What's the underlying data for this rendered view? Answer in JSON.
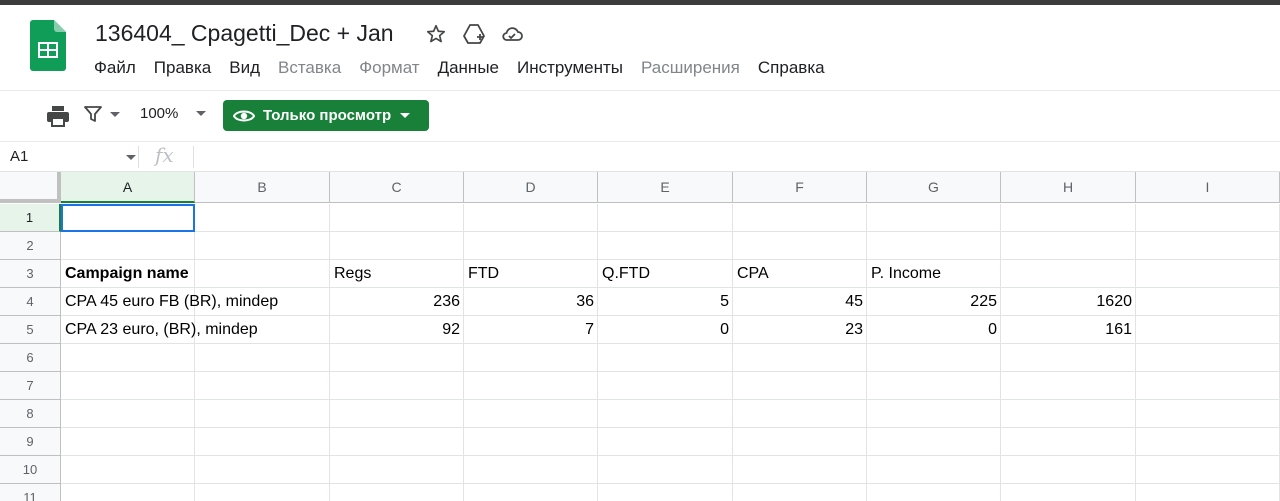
{
  "document": {
    "title": "136404_ Cpagetti_Dec + Jan"
  },
  "icons": {
    "star": "star-icon",
    "move_to_drive": "drive-move-icon",
    "cloud_status": "cloud-saved-icon"
  },
  "menu": [
    {
      "label": "Файл",
      "disabled": false
    },
    {
      "label": "Правка",
      "disabled": false
    },
    {
      "label": "Вид",
      "disabled": false
    },
    {
      "label": "Вставка",
      "disabled": true
    },
    {
      "label": "Формат",
      "disabled": true
    },
    {
      "label": "Данные",
      "disabled": false
    },
    {
      "label": "Инструменты",
      "disabled": false
    },
    {
      "label": "Расширения",
      "disabled": true
    },
    {
      "label": "Справка",
      "disabled": false
    }
  ],
  "toolbar": {
    "zoom": "100%",
    "view_only_label": "Только просмотр"
  },
  "formula_bar": {
    "cell_ref": "A1",
    "fx": "fx",
    "value": ""
  },
  "columns": [
    "A",
    "B",
    "C",
    "D",
    "E",
    "F",
    "G",
    "H",
    "I"
  ],
  "rows": [
    "1",
    "2",
    "3",
    "4",
    "5",
    "6",
    "7",
    "8",
    "9",
    "10",
    "11"
  ],
  "cells": {
    "A3": "Campaign name",
    "C3": "Regs",
    "D3": "FTD",
    "E3": "Q.FTD",
    "F3": "CPA",
    "G3": "P. Income",
    "A4": "CPA 45 euro FB (BR), mindep",
    "C4": "236",
    "D4": "36",
    "E4": "5",
    "F4": "45",
    "G4": "225",
    "H4": "1620",
    "A5": "CPA 23 euro, (BR), mindep",
    "C5": "92",
    "D5": "7",
    "E5": "0",
    "F5": "23",
    "G5": "0",
    "H5": "161"
  },
  "colors": {
    "accent_green": "#188038",
    "selection_blue": "#1a73e8",
    "header_bg": "#f8f9fa",
    "selected_header_bg": "#e6f4ea"
  }
}
